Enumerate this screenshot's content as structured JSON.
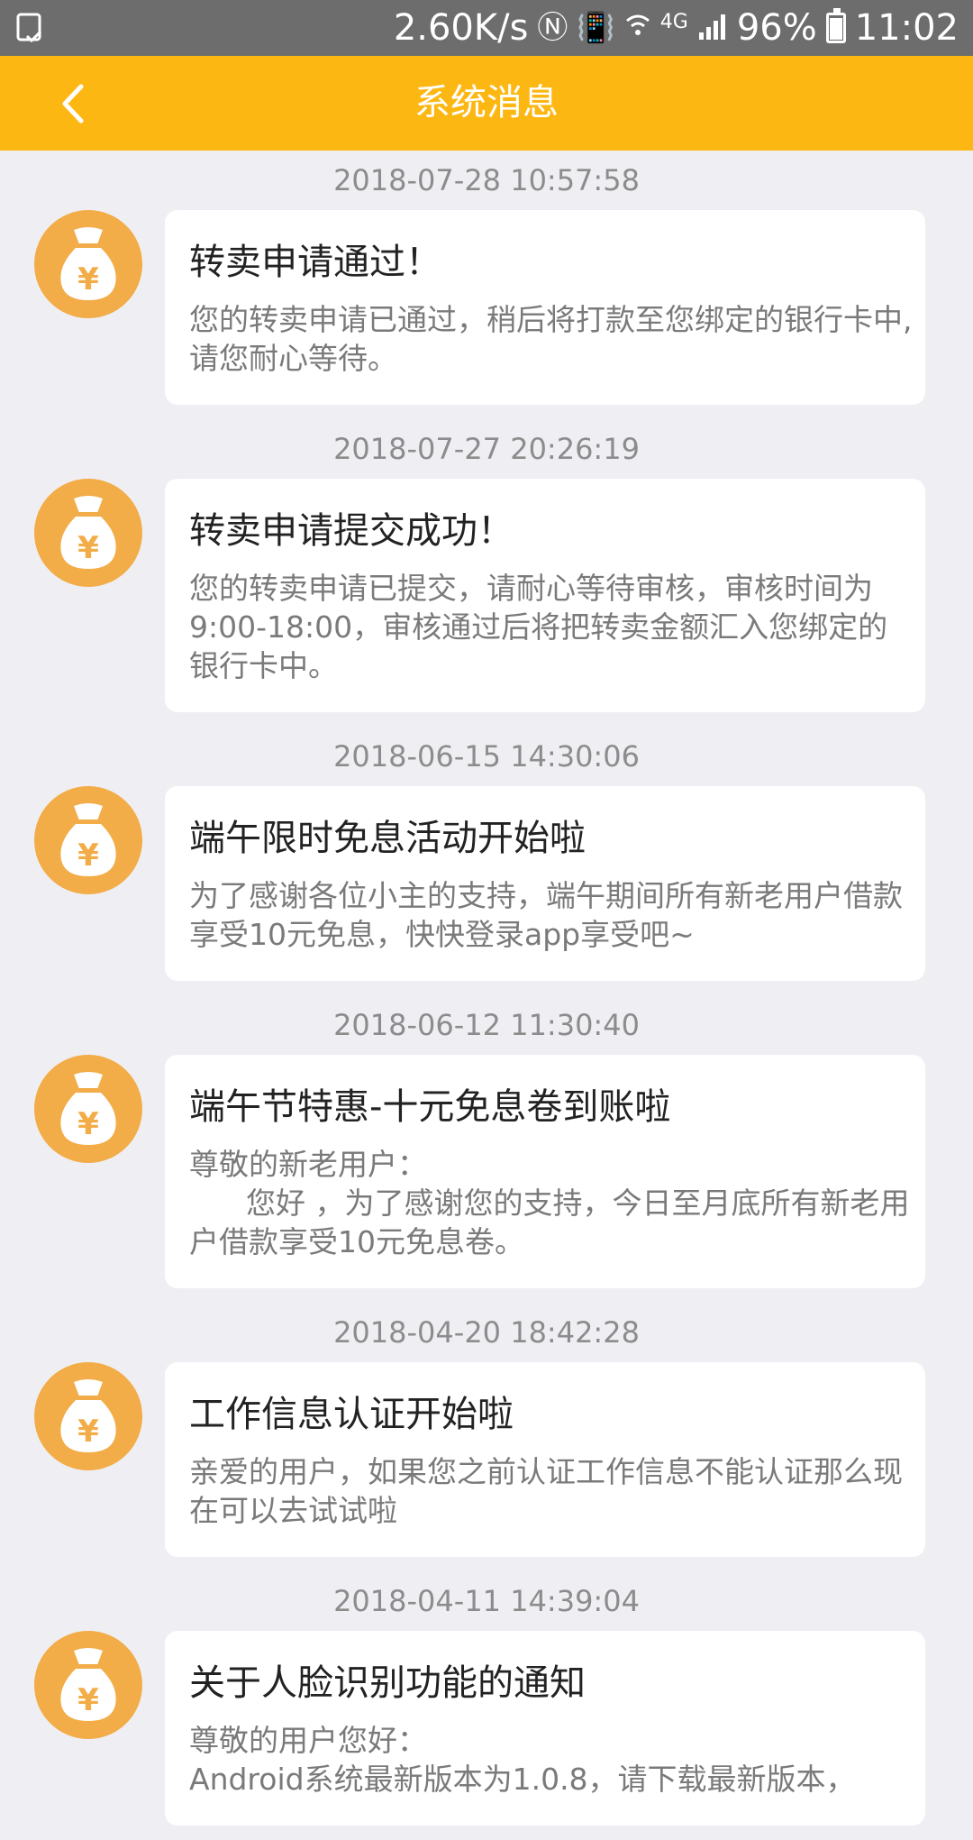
{
  "status_bar": {
    "speed": "2.60K/s",
    "network": "4G",
    "battery": "96%",
    "time": "11:02"
  },
  "header": {
    "title": "系统消息"
  },
  "messages": [
    {
      "time": "2018-07-28 10:57:58",
      "title": "转卖申请通过！",
      "body": "您的转卖申请已通过，稍后将打款至您绑定的银行卡中,请您耐心等待。"
    },
    {
      "time": "2018-07-27 20:26:19",
      "title": "转卖申请提交成功！",
      "body": "您的转卖申请已提交，请耐心等待审核，审核时间为9:00-18:00，审核通过后将把转卖金额汇入您绑定的银行卡中。"
    },
    {
      "time": "2018-06-15 14:30:06",
      "title": "端午限时免息活动开始啦",
      "body": "为了感谢各位小主的支持，端午期间所有新老用户借款享受10元免息，快快登录app享受吧~"
    },
    {
      "time": "2018-06-12 11:30:40",
      "title": "端午节特惠-十元免息卷到账啦",
      "body": "尊敬的新老用户：\n      您好 ，为了感谢您的支持，今日至月底所有新老用户借款享受10元免息卷。"
    },
    {
      "time": "2018-04-20 18:42:28",
      "title": "工作信息认证开始啦",
      "body": "亲爱的用户，如果您之前认证工作信息不能认证那么现在可以去试试啦"
    },
    {
      "time": "2018-04-11 14:39:04",
      "title": "关于人脸识别功能的通知",
      "body": "尊敬的用户您好：\nAndroid系统最新版本为1.0.8，请下载最新版本，"
    }
  ],
  "colors": {
    "header": "#fdb712",
    "avatar": "#f2ac48",
    "background": "#efeff3"
  },
  "icons": {
    "back": "chevron-left-icon",
    "avatar": "money-bag-icon"
  }
}
